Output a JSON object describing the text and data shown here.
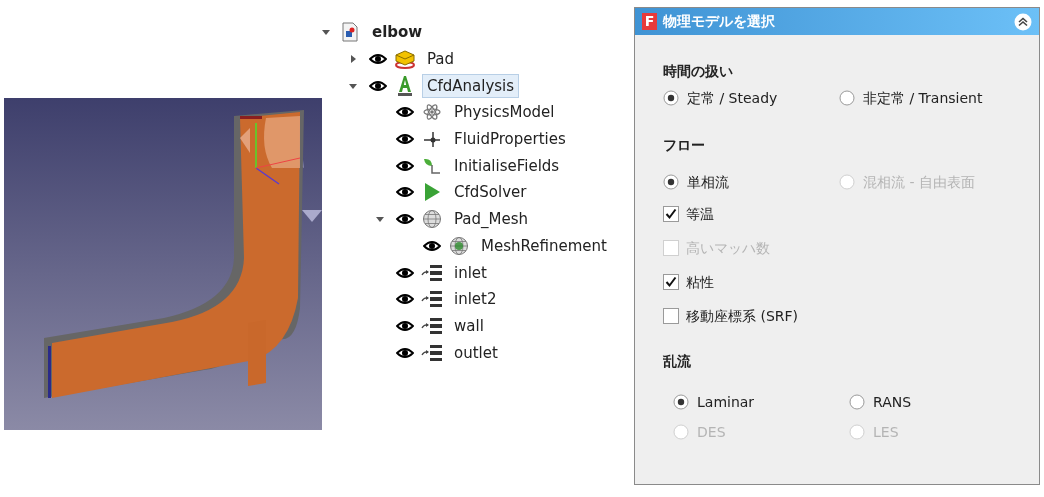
{
  "tree": [
    {
      "label": "elbow",
      "kind": "document",
      "expanded": true,
      "visible_toggle": false,
      "selected": false,
      "children": [
        {
          "label": "Pad",
          "kind": "pad",
          "expanded": false,
          "visible_toggle": true,
          "selected": false
        },
        {
          "label": "CfdAnalysis",
          "kind": "analysis",
          "expanded": true,
          "visible_toggle": true,
          "selected": true,
          "children": [
            {
              "label": "PhysicsModel",
              "kind": "physics",
              "visible_toggle": true,
              "selected": false
            },
            {
              "label": "FluidProperties",
              "kind": "fluid",
              "visible_toggle": true,
              "selected": false
            },
            {
              "label": "InitialiseFields",
              "kind": "init",
              "visible_toggle": true,
              "selected": false
            },
            {
              "label": "CfdSolver",
              "kind": "solver",
              "visible_toggle": true,
              "selected": false
            },
            {
              "label": "Pad_Mesh",
              "kind": "mesh",
              "expanded": true,
              "visible_toggle": true,
              "selected": false,
              "children": [
                {
                  "label": "MeshRefinement",
                  "kind": "refinement",
                  "visible_toggle": true,
                  "selected": false
                }
              ]
            },
            {
              "label": "inlet",
              "kind": "boundary",
              "visible_toggle": true,
              "selected": false
            },
            {
              "label": "inlet2",
              "kind": "boundary",
              "visible_toggle": true,
              "selected": false
            },
            {
              "label": "wall",
              "kind": "boundary",
              "visible_toggle": true,
              "selected": false
            },
            {
              "label": "outlet",
              "kind": "boundary",
              "visible_toggle": true,
              "selected": false
            }
          ]
        }
      ]
    }
  ],
  "panel": {
    "logo": "F",
    "title": "物理モデルを選択",
    "sections": [
      {
        "title": "時間の扱い",
        "options": [
          {
            "kind": "radio",
            "label": "定常 / Steady",
            "selected": true,
            "disabled": false
          },
          {
            "kind": "radio",
            "label": "非定常 / Transient",
            "selected": false,
            "disabled": false
          }
        ]
      },
      {
        "title": "フロー",
        "options": [
          {
            "kind": "radio",
            "label": "単相流",
            "selected": true,
            "disabled": false
          },
          {
            "kind": "radio",
            "label": "混相流 - 自由表面",
            "selected": false,
            "disabled": true
          },
          {
            "kind": "checkbox",
            "label": "等温",
            "checked": true,
            "disabled": false
          },
          {
            "kind": "checkbox",
            "label": "高いマッハ数",
            "checked": false,
            "disabled": true
          },
          {
            "kind": "checkbox",
            "label": "粘性",
            "checked": true,
            "disabled": false
          },
          {
            "kind": "checkbox",
            "label": "移動座標系 (SRF)",
            "checked": false,
            "disabled": false
          }
        ]
      },
      {
        "title": "乱流",
        "options": [
          {
            "kind": "radio",
            "label": "Laminar",
            "selected": true,
            "disabled": false
          },
          {
            "kind": "radio",
            "label": "RANS",
            "selected": false,
            "disabled": false
          },
          {
            "kind": "radio",
            "label": "DES",
            "selected": false,
            "disabled": true
          },
          {
            "kind": "radio",
            "label": "LES",
            "selected": false,
            "disabled": true
          }
        ]
      }
    ]
  }
}
